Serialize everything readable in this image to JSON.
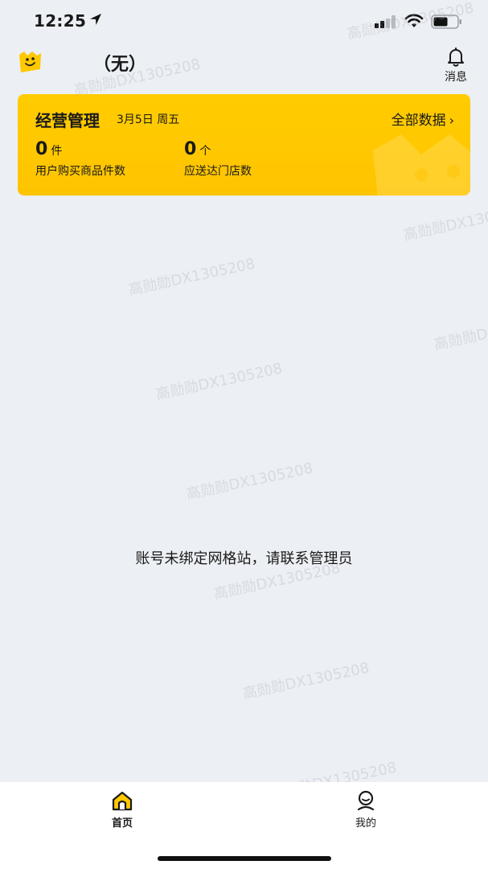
{
  "status_bar": {
    "time": "12:25",
    "icons": [
      "location-arrow-icon",
      "cellular-signal-icon",
      "wifi-icon",
      "battery-icon"
    ]
  },
  "header": {
    "station_name": "（无）",
    "message_label": "消息",
    "icons": [
      "app-logo-icon",
      "bell-icon"
    ]
  },
  "card": {
    "title": "经营管理",
    "date": "3月5日 周五",
    "all_data": "全部数据",
    "stats": [
      {
        "value": "0",
        "unit": "件",
        "label": "用户购买商品件数"
      },
      {
        "value": "0",
        "unit": "个",
        "label": "应送达门店数"
      }
    ],
    "color": "#ffc800"
  },
  "empty_message": "账号未绑定网格站，请联系管理员",
  "watermark": "高勋勋DX1305208",
  "tabs": [
    {
      "label": "首页",
      "icon": "home-icon",
      "active": true
    },
    {
      "label": "我的",
      "icon": "user-icon",
      "active": false
    }
  ],
  "colors": {
    "background": "#eceff3",
    "accent": "#ffc800",
    "text": "#1a1a1a"
  }
}
